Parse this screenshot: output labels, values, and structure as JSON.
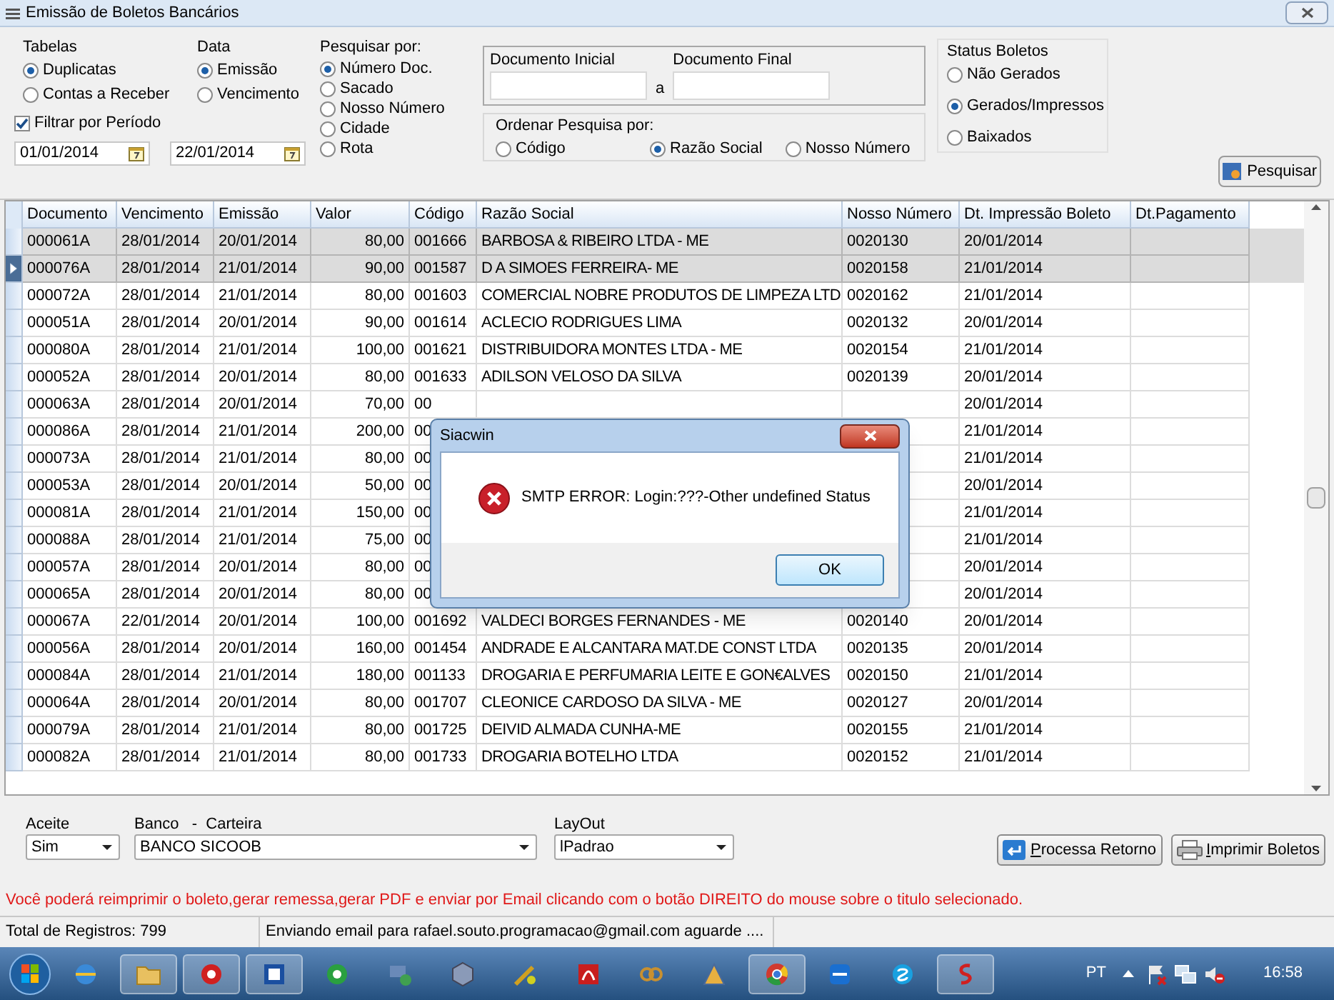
{
  "window": {
    "title": "Emissão de Boletos Bancários"
  },
  "filters": {
    "tabelas": {
      "label": "Tabelas",
      "options": [
        {
          "label": "Duplicatas",
          "selected": true
        },
        {
          "label": "Contas a Receber",
          "selected": false
        }
      ]
    },
    "data": {
      "label": "Data",
      "options": [
        {
          "label": "Emissão",
          "selected": true
        },
        {
          "label": "Vencimento",
          "selected": false
        }
      ]
    },
    "pesquisar_por": {
      "label": "Pesquisar por:",
      "options": [
        {
          "label": "Número Doc.",
          "selected": true
        },
        {
          "label": "Sacado",
          "selected": false
        },
        {
          "label": "Nosso Número",
          "selected": false
        },
        {
          "label": "Cidade",
          "selected": false
        },
        {
          "label": "Rota",
          "selected": false
        }
      ]
    },
    "filtrar_periodo": {
      "label": "Filtrar por Período",
      "checked": true
    },
    "date_from": {
      "value": "01/01/2014"
    },
    "date_to": {
      "value": "22/01/2014"
    },
    "documento_inicial": {
      "label": "Documento Inicial"
    },
    "range_separator": "a",
    "documento_final": {
      "label": "Documento Final"
    },
    "ordenar": {
      "label": "Ordenar Pesquisa por:",
      "options": [
        {
          "label": "Código",
          "selected": false
        },
        {
          "label": "Razão Social",
          "selected": true
        },
        {
          "label": "Nosso Número",
          "selected": false
        }
      ]
    },
    "status_boletos": {
      "label": "Status Boletos",
      "options": [
        {
          "label": "Não Gerados",
          "selected": false
        },
        {
          "label": "Gerados/Impressos",
          "selected": true
        },
        {
          "label": "Baixados",
          "selected": false
        }
      ]
    },
    "search_button": "Pesquisar"
  },
  "table": {
    "columns": [
      "Documento",
      "Vencimento",
      "Emissão",
      "Valor",
      "Código",
      "Razão Social",
      "Nosso Número",
      "Dt. Impressão Boleto",
      "Dt.Pagamento"
    ],
    "rows": [
      {
        "selected": true,
        "current": false,
        "cells": [
          "000061A",
          "28/01/2014",
          "20/01/2014",
          "80,00",
          "001666",
          "BARBOSA & RIBEIRO LTDA - ME",
          "0020130",
          "20/01/2014"
        ]
      },
      {
        "selected": true,
        "current": true,
        "cells": [
          "000076A",
          "28/01/2014",
          "21/01/2014",
          "90,00",
          "001587",
          "D A SIMOES FERREIRA- ME",
          "0020158",
          "21/01/2014"
        ]
      },
      {
        "selected": false,
        "current": false,
        "cells": [
          "000072A",
          "28/01/2014",
          "21/01/2014",
          "80,00",
          "001603",
          "COMERCIAL NOBRE PRODUTOS DE LIMPEZA LTD",
          "0020162",
          "21/01/2014"
        ]
      },
      {
        "selected": false,
        "current": false,
        "cells": [
          "000051A",
          "28/01/2014",
          "20/01/2014",
          "90,00",
          "001614",
          "ACLECIO RODRIGUES LIMA",
          "0020132",
          "20/01/2014"
        ]
      },
      {
        "selected": false,
        "current": false,
        "cells": [
          "000080A",
          "28/01/2014",
          "21/01/2014",
          "100,00",
          "001621",
          "DISTRIBUIDORA MONTES LTDA - ME",
          "0020154",
          "21/01/2014"
        ]
      },
      {
        "selected": false,
        "current": false,
        "cells": [
          "000052A",
          "28/01/2014",
          "20/01/2014",
          "80,00",
          "001633",
          "ADILSON VELOSO DA SILVA",
          "0020139",
          "20/01/2014"
        ]
      },
      {
        "selected": false,
        "current": false,
        "cells": [
          "000063A",
          "28/01/2014",
          "20/01/2014",
          "70,00",
          "00",
          null,
          null,
          "20/01/2014"
        ]
      },
      {
        "selected": false,
        "current": false,
        "cells": [
          "000086A",
          "28/01/2014",
          "21/01/2014",
          "200,00",
          "00",
          null,
          null,
          "21/01/2014"
        ]
      },
      {
        "selected": false,
        "current": false,
        "cells": [
          "000073A",
          "28/01/2014",
          "21/01/2014",
          "80,00",
          "00",
          null,
          null,
          "21/01/2014"
        ]
      },
      {
        "selected": false,
        "current": false,
        "cells": [
          "000053A",
          "28/01/2014",
          "20/01/2014",
          "50,00",
          "00",
          null,
          null,
          "20/01/2014"
        ]
      },
      {
        "selected": false,
        "current": false,
        "cells": [
          "000081A",
          "28/01/2014",
          "21/01/2014",
          "150,00",
          "00",
          null,
          null,
          "21/01/2014"
        ]
      },
      {
        "selected": false,
        "current": false,
        "cells": [
          "000088A",
          "28/01/2014",
          "21/01/2014",
          "75,00",
          "00",
          null,
          null,
          "21/01/2014"
        ]
      },
      {
        "selected": false,
        "current": false,
        "cells": [
          "000057A",
          "28/01/2014",
          "20/01/2014",
          "80,00",
          "00",
          null,
          null,
          "20/01/2014"
        ]
      },
      {
        "selected": false,
        "current": false,
        "cells": [
          "000065A",
          "28/01/2014",
          "20/01/2014",
          "80,00",
          "00",
          null,
          null,
          "20/01/2014"
        ]
      },
      {
        "selected": false,
        "current": false,
        "cells": [
          "000067A",
          "22/01/2014",
          "20/01/2014",
          "100,00",
          "001692",
          "VALDECI BORGES FERNANDES - ME",
          "0020140",
          "20/01/2014"
        ]
      },
      {
        "selected": false,
        "current": false,
        "cells": [
          "000056A",
          "28/01/2014",
          "20/01/2014",
          "160,00",
          "001454",
          "ANDRADE E ALCANTARA MAT.DE CONST LTDA",
          "0020135",
          "20/01/2014"
        ]
      },
      {
        "selected": false,
        "current": false,
        "cells": [
          "000084A",
          "28/01/2014",
          "21/01/2014",
          "180,00",
          "001133",
          "DROGARIA E PERFUMARIA LEITE E GON€ALVES",
          "0020150",
          "21/01/2014"
        ]
      },
      {
        "selected": false,
        "current": false,
        "cells": [
          "000064A",
          "28/01/2014",
          "20/01/2014",
          "80,00",
          "001707",
          "CLEONICE CARDOSO DA SILVA - ME",
          "0020127",
          "20/01/2014"
        ]
      },
      {
        "selected": false,
        "current": false,
        "cells": [
          "000079A",
          "28/01/2014",
          "21/01/2014",
          "80,00",
          "001725",
          "DEIVID ALMADA CUNHA-ME",
          "0020155",
          "21/01/2014"
        ]
      },
      {
        "selected": false,
        "current": false,
        "cells": [
          "000082A",
          "28/01/2014",
          "21/01/2014",
          "80,00",
          "001733",
          "DROGARIA BOTELHO LTDA",
          "0020152",
          "21/01/2014"
        ]
      }
    ]
  },
  "bottom": {
    "aceite": {
      "label": "Aceite",
      "value": "Sim"
    },
    "banco": {
      "label": "Banco   -  Carteira",
      "value": "BANCO SICOOB"
    },
    "layout": {
      "label": "LayOut",
      "value": "lPadrao"
    },
    "buttons": [
      {
        "kind": "retorno",
        "label": "Processa Retorno"
      },
      {
        "kind": "print",
        "label": "Imprimir Boletos"
      }
    ],
    "notice": "Você poderá reimprimir o boleto,gerar remessa,gerar PDF e enviar por Email clicando com o botão DIREITO do mouse sobre o titulo selecionado."
  },
  "status_bar": [
    "Total de Registros: 799",
    "Enviando email para rafael.souto.programacao@gmail.com aguarde ...."
  ],
  "dialog": {
    "title": "Siacwin",
    "message": "SMTP ERROR: Login:???-Other undefined Status",
    "button": "OK"
  },
  "taskbar": {
    "apps": [
      {
        "kind": "globe",
        "active": false
      },
      {
        "kind": "folder",
        "active": true
      },
      {
        "kind": "lifebuoy",
        "active": true
      },
      {
        "kind": "db",
        "active": true
      },
      {
        "kind": "green",
        "active": false
      },
      {
        "kind": "monitor",
        "active": false
      },
      {
        "kind": "cube",
        "active": false
      },
      {
        "kind": "tools",
        "active": false
      },
      {
        "kind": "pdf",
        "active": false
      },
      {
        "kind": "chain",
        "active": false
      },
      {
        "kind": "triangle",
        "active": false
      },
      {
        "kind": "chrome",
        "active": true
      },
      {
        "kind": "teamviewer",
        "active": false
      },
      {
        "kind": "skype",
        "active": false
      },
      {
        "kind": "swirl",
        "active": true
      }
    ],
    "language": "PT",
    "clock": "16:58"
  }
}
